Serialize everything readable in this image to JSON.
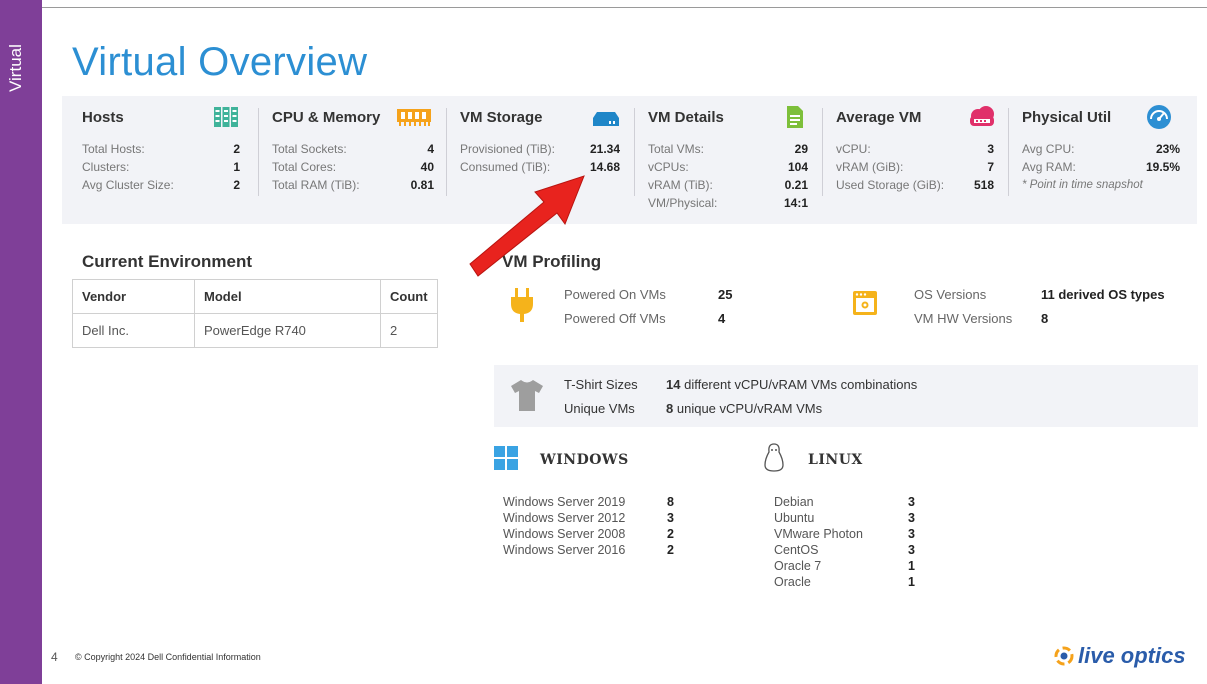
{
  "sidebar": {
    "label": "Virtual"
  },
  "page": {
    "title": "Virtual Overview"
  },
  "cards": {
    "hosts": {
      "title": "Hosts",
      "rows": [
        {
          "label": "Total Hosts:",
          "value": "2"
        },
        {
          "label": "Clusters:",
          "value": "1"
        },
        {
          "label": "Avg Cluster Size:",
          "value": "2"
        }
      ]
    },
    "cpu_memory": {
      "title": "CPU & Memory",
      "rows": [
        {
          "label": "Total Sockets:",
          "value": "4"
        },
        {
          "label": "Total Cores:",
          "value": "40"
        },
        {
          "label": "Total RAM (TiB):",
          "value": "0.81"
        }
      ]
    },
    "vm_storage": {
      "title": "VM Storage",
      "rows": [
        {
          "label": "Provisioned (TiB):",
          "value": "21.34"
        },
        {
          "label": "Consumed (TiB):",
          "value": "14.68"
        }
      ]
    },
    "vm_details": {
      "title": "VM Details",
      "rows": [
        {
          "label": "Total VMs:",
          "value": "29"
        },
        {
          "label": "vCPUs:",
          "value": "104"
        },
        {
          "label": "vRAM (TiB):",
          "value": "0.21"
        },
        {
          "label": "VM/Physical:",
          "value": "14:1"
        }
      ]
    },
    "average_vm": {
      "title": "Average VM",
      "rows": [
        {
          "label": "vCPU:",
          "value": "3"
        },
        {
          "label": "vRAM (GiB):",
          "value": "7"
        },
        {
          "label": "Used Storage (GiB):",
          "value": "518"
        }
      ]
    },
    "physical_util": {
      "title": "Physical Util",
      "rows": [
        {
          "label": "Avg CPU:",
          "value": "23%"
        },
        {
          "label": "Avg RAM:",
          "value": "19.5%"
        }
      ],
      "note": "* Point in time snapshot"
    }
  },
  "environment": {
    "title": "Current Environment",
    "columns": [
      "Vendor",
      "Model",
      "Count"
    ],
    "rows": [
      [
        "Dell Inc.",
        "PowerEdge R740",
        "2"
      ]
    ]
  },
  "profiling": {
    "title": "VM Profiling",
    "powered_on_label": "Powered On VMs",
    "powered_on_value": "25",
    "powered_off_label": "Powered Off VMs",
    "powered_off_value": "4",
    "os_versions_label": "OS Versions",
    "os_versions_value": "11 derived OS types",
    "hw_versions_label": "VM HW Versions",
    "hw_versions_value": "8"
  },
  "tshirt": {
    "sizes_label": "T-Shirt Sizes",
    "sizes_count": "14",
    "sizes_text": "different vCPU/vRAM VMs combinations",
    "unique_label": "Unique VMs",
    "unique_count": "8",
    "unique_text": "unique vCPU/vRAM VMs"
  },
  "windows": {
    "heading": "WINDOWS",
    "items": [
      {
        "name": "Windows Server 2019",
        "count": "8"
      },
      {
        "name": "Windows Server 2012",
        "count": "3"
      },
      {
        "name": "Windows Server 2008",
        "count": "2"
      },
      {
        "name": "Windows Server 2016",
        "count": "2"
      }
    ]
  },
  "linux": {
    "heading": "LINUX",
    "items": [
      {
        "name": "Debian",
        "count": "3"
      },
      {
        "name": "Ubuntu",
        "count": "3"
      },
      {
        "name": "VMware Photon",
        "count": "3"
      },
      {
        "name": "CentOS",
        "count": "3"
      },
      {
        "name": "Oracle 7",
        "count": "1"
      },
      {
        "name": "Oracle",
        "count": "1"
      }
    ]
  },
  "footer": {
    "page_number": "4",
    "copyright": "© Copyright 2024 Dell Confidential Information",
    "brand": "live optics"
  },
  "colors": {
    "sidebar": "#7f3f98",
    "title": "#2c8fd3",
    "band": "#f2f3f7",
    "arrow": "#e8231e",
    "brand": "#2a5caa"
  }
}
